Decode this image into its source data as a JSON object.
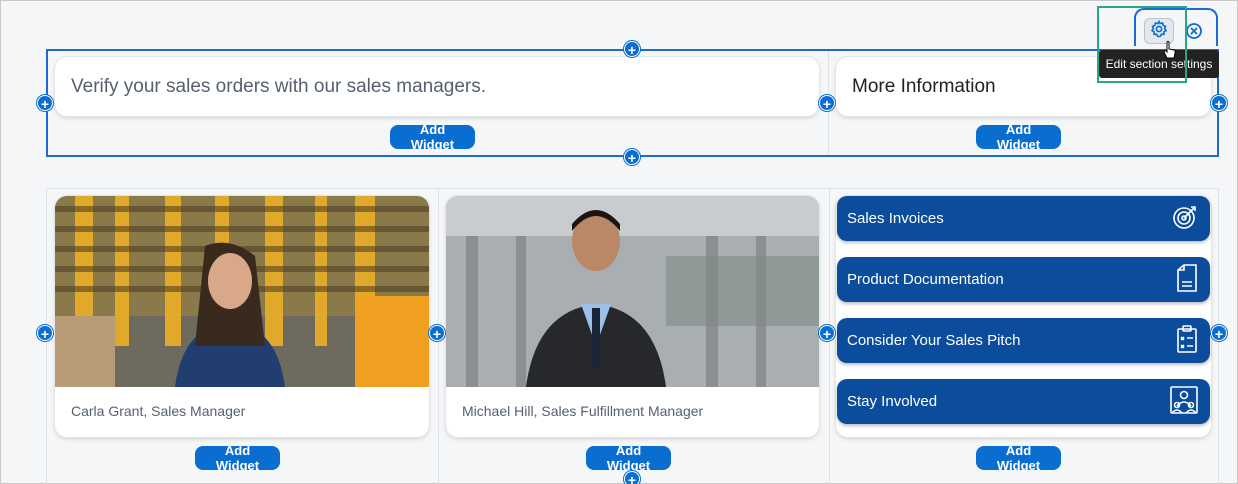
{
  "section1": {
    "text_widget": "Verify your sales orders with our sales managers.",
    "title_widget": "More Information",
    "add_widget_label": "Add Widget"
  },
  "section2": {
    "persons": [
      {
        "caption": "Carla Grant, Sales Manager"
      },
      {
        "caption": "Michael Hill, Sales Fulfillment Manager"
      }
    ],
    "links": [
      {
        "label": "Sales Invoices",
        "icon": "target-icon"
      },
      {
        "label": "Product Documentation",
        "icon": "document-icon"
      },
      {
        "label": "Consider Your Sales Pitch",
        "icon": "clipboard-icon"
      },
      {
        "label": "Stay Involved",
        "icon": "people-icon"
      }
    ],
    "add_widget_label": "Add Widget"
  },
  "toolbar": {
    "tooltip": "Edit section settings",
    "gear_icon": "gear-icon",
    "close_icon": "close-circle-icon"
  },
  "colors": {
    "accent": "#0a6ed1",
    "link_button": "#0b4d9c",
    "selection_border": "#1b6bd6",
    "highlight": "#2aa58a"
  }
}
